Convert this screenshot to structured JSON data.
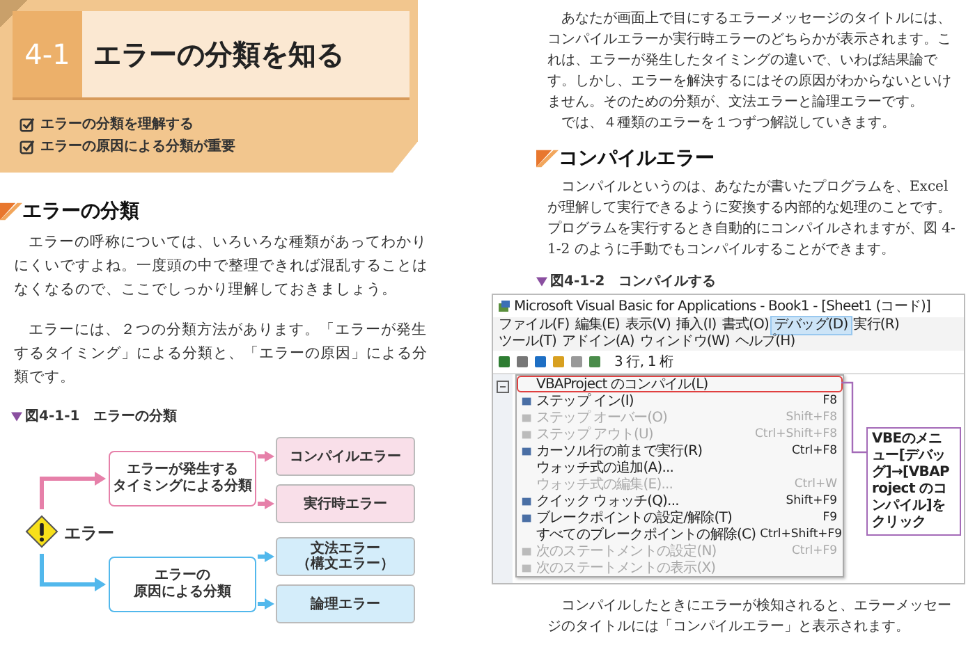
{
  "left_page": {
    "section": {
      "number": "4-1",
      "title": "エラーの分類を知る",
      "goals": [
        {
          "text": "エラーの分類を理解する",
          "checked": true
        },
        {
          "text": "エラーの原因による分類が重要",
          "checked": true
        }
      ]
    },
    "heading": "エラーの分類",
    "paragraphs": [
      "エラーの呼称については、いろいろな種類があってわかりにくいですよね。一度頭の中で整理できれば混乱することはなくなるので、ここでしっかり理解しておきましょう。",
      "エラーには、２つの分類方法があります。「エラーが発生するタイミング」による分類と、「エラーの原因」による分類です。"
    ],
    "figure": {
      "label": "図4-1-1",
      "title": "エラーの分類",
      "root": "エラー",
      "groups": [
        {
          "label_lines": [
            "エラーが発生する",
            "タイミングによる分類"
          ],
          "color": "#e680a9",
          "items": [
            {
              "lines": [
                "コンパイルエラー"
              ]
            },
            {
              "lines": [
                "実行時エラー"
              ]
            }
          ]
        },
        {
          "label_lines": [
            "エラーの",
            "原因による分類"
          ],
          "color": "#52b8ec",
          "items": [
            {
              "lines": [
                "文法エラー",
                "（構文エラー）"
              ]
            },
            {
              "lines": [
                "論理エラー"
              ]
            }
          ]
        }
      ]
    }
  },
  "right_page": {
    "paragraphs": [
      "あなたが画面上で目にするエラーメッセージのタイトルには、コンパイルエラーか実行時エラーのどちらかが表示されます。これは、エラーが発生したタイミングの違いで、いわば結果論です。しかし、エラーを解決するにはその原因がわからないといけません。そのための分類が、文法エラーと論理エラーです。",
      "では、４種類のエラーを１つずつ解説していきます。"
    ],
    "heading": "コンパイルエラー",
    "body": "コンパイルというのは、あなたが書いたプログラムを、Excel が理解して実行できるように変換する内部的な処理のことです。プログラムを実行するとき自動的にコンパイルされますが、図 4-1-2 のように手動でもコンパイルすることができます。",
    "figure": {
      "label": "図4-1-2",
      "title": "コンパイルする",
      "screenshot": {
        "window_title": "Microsoft Visual Basic for Applications - Book1 - [Sheet1 (コード)]",
        "menubar": [
          {
            "label": "ファイル(F)",
            "selected": false
          },
          {
            "label": "編集(E)",
            "selected": false
          },
          {
            "label": "表示(V)",
            "selected": false
          },
          {
            "label": "挿入(I)",
            "selected": false
          },
          {
            "label": "書式(O)",
            "selected": false
          },
          {
            "label": "デバッグ(D)",
            "selected": true
          },
          {
            "label": "実行(R)",
            "selected": false
          },
          {
            "label": "ツール(T)",
            "selected": false
          },
          {
            "label": "アドイン(A)",
            "selected": false
          },
          {
            "label": "ウィンドウ(W)",
            "selected": false
          },
          {
            "label": "ヘルプ(H)",
            "selected": false
          }
        ],
        "cursor_position": "3 行, 1 桁",
        "menu": [
          {
            "label": "VBAProject のコンパイル(L)",
            "disabled": false,
            "highlighted": true,
            "has_icon": false
          },
          {
            "label": "ステップ イン(I)",
            "shortcut": "F8",
            "disabled": false,
            "highlighted": false,
            "has_icon": true
          },
          {
            "label": "ステップ オーバー(O)",
            "shortcut": "Shift+F8",
            "disabled": true,
            "highlighted": false,
            "has_icon": true
          },
          {
            "label": "ステップ アウト(U)",
            "shortcut": "Ctrl+Shift+F8",
            "disabled": true,
            "highlighted": false,
            "has_icon": true
          },
          {
            "label": "カーソル行の前まで実行(R)",
            "shortcut": "Ctrl+F8",
            "disabled": false,
            "highlighted": false,
            "has_icon": true
          },
          {
            "label": "ウォッチ式の追加(A)...",
            "disabled": false,
            "highlighted": false,
            "has_icon": false
          },
          {
            "label": "ウォッチ式の編集(E)...",
            "shortcut": "Ctrl+W",
            "disabled": true,
            "highlighted": false,
            "has_icon": false
          },
          {
            "label": "クイック ウォッチ(Q)...",
            "shortcut": "Shift+F9",
            "disabled": false,
            "highlighted": false,
            "has_icon": true
          },
          {
            "label": "ブレークポイントの設定/解除(T)",
            "shortcut": "F9",
            "disabled": false,
            "highlighted": false,
            "has_icon": true
          },
          {
            "label": "すべてのブレークポイントの解除(C)",
            "shortcut": "Ctrl+Shift+F9",
            "disabled": false,
            "highlighted": false,
            "has_icon": false
          },
          {
            "label": "次のステートメントの設定(N)",
            "shortcut": "Ctrl+F9",
            "disabled": true,
            "highlighted": false,
            "has_icon": true
          },
          {
            "label": "次のステートメントの表示(X)",
            "disabled": true,
            "highlighted": false,
            "has_icon": true
          }
        ],
        "callout": "VBEのメニュー[デバッグ]→[VBAProject のコンパイル]をクリック"
      }
    },
    "closing": "コンパイルしたときにエラーが検知されると、エラーメッセージのタイトルには「コンパイルエラー」と表示されます。"
  }
}
